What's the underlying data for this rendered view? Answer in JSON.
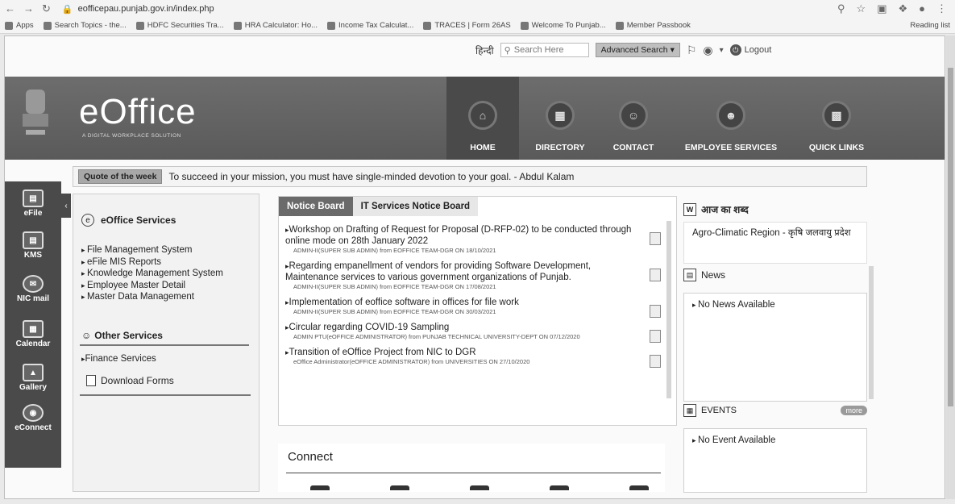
{
  "browser": {
    "url": "eofficepau.punjab.gov.in/index.php",
    "bookmarks": [
      {
        "label": "Apps"
      },
      {
        "label": "Search Topics - the..."
      },
      {
        "label": "HDFC Securities Tra..."
      },
      {
        "label": "HRA Calculator: Ho..."
      },
      {
        "label": "Income Tax Calculat..."
      },
      {
        "label": "TRACES | Form 26AS"
      },
      {
        "label": "Welcome To Punjab..."
      },
      {
        "label": "Member Passbook"
      }
    ],
    "reading_list": "Reading list"
  },
  "topbar": {
    "hindi_label": "हिन्दी",
    "search_placeholder": "Search Here",
    "advanced_search": "Advanced Search",
    "logout": "Logout"
  },
  "banner": {
    "logo": "eOffice",
    "tagline": "A DIGITAL WORKPLACE SOLUTION",
    "nav": [
      {
        "label": "HOME",
        "icon": "home-icon"
      },
      {
        "label": "DIRECTORY",
        "icon": "directory-icon"
      },
      {
        "label": "CONTACT",
        "icon": "contact-icon"
      },
      {
        "label": "EMPLOYEE SERVICES",
        "icon": "employee-icon"
      },
      {
        "label": "QUICK LINKS",
        "icon": "quick-links-icon"
      }
    ]
  },
  "quote": {
    "label": "Quote of the week",
    "text": "To succeed in your mission, you must have single-minded devotion to your goal. - Abdul Kalam"
  },
  "dock": [
    {
      "label": "eFile",
      "icon": "efile-icon"
    },
    {
      "label": "KMS",
      "icon": "kms-icon"
    },
    {
      "label": "NIC mail",
      "icon": "mail-icon"
    },
    {
      "label": "Calendar",
      "icon": "calendar-icon"
    },
    {
      "label": "Gallery",
      "icon": "gallery-icon"
    },
    {
      "label": "eConnect",
      "icon": "econnect-icon"
    }
  ],
  "services": {
    "eoffice_title": "eOffice Services",
    "items": [
      "File Management System",
      "eFile MIS Reports",
      "Knowledge Management System",
      "Employee Master Detail",
      "Master Data Management"
    ],
    "other_title": "Other Services",
    "finance": "Finance Services",
    "download": "Download Forms"
  },
  "notice_board": {
    "tabs": [
      "Notice Board",
      "IT Services Notice Board"
    ],
    "items": [
      {
        "title": "Workshop on Drafting of Request for Proposal (D-RFP-02) to be conducted through online mode on 28th January 2022",
        "meta": "ADMIN-II(SUPER SUB ADMIN) from EOFFICE TEAM-DGR ON 18/10/2021"
      },
      {
        "title": "Regarding empanellment of vendors for providing Software Development, Maintenance services to various government organizations of Punjab.",
        "meta": "ADMIN-II(SUPER SUB ADMIN) from EOFFICE TEAM-DGR ON 17/08/2021"
      },
      {
        "title": "Implementation of eoffice software in offices for file work",
        "meta": "ADMIN-II(SUPER SUB ADMIN) from EOFFICE TEAM-DGR ON 30/03/2021"
      },
      {
        "title": "Circular regarding COVID-19 Sampling",
        "meta": "ADMIN PTU(eOFFICE ADMINISTRATOR) from PUNJAB TECHNICAL UNIVERSITY-DEPT ON 07/12/2020"
      },
      {
        "title": "Transition of eOffice Project from NIC to DGR",
        "meta": "eOffice Administrator(eOFFICE ADMINISTRATOR) from UNIVERSITIES ON 27/10/2020"
      }
    ]
  },
  "connect": {
    "title": "Connect"
  },
  "word_of_day": {
    "title": "आज का शब्द",
    "text": "Agro-Climatic Region - कृषि जलवायु प्रदेश"
  },
  "news": {
    "title": "News",
    "empty": "No News Available"
  },
  "events": {
    "title": "EVENTS",
    "more": "more",
    "empty": "No Event Available"
  }
}
